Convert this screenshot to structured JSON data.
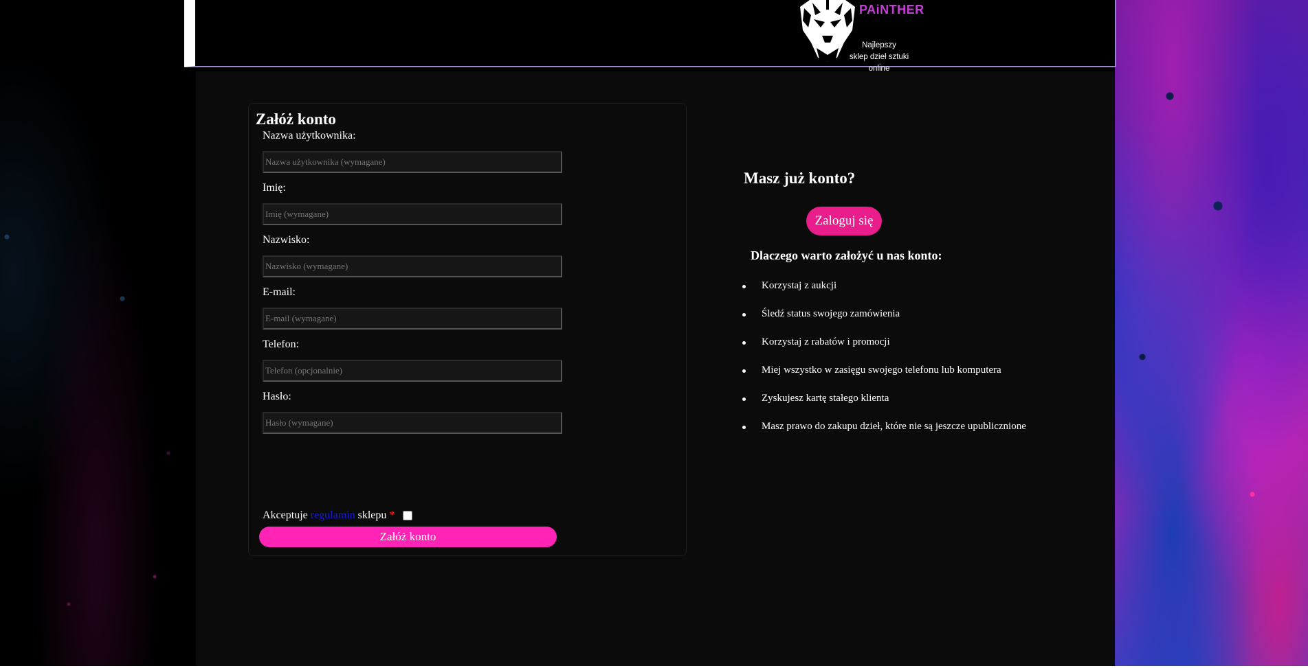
{
  "header": {
    "brand": "PAiNTHER",
    "tagline_line1": "Najlepszy",
    "tagline_line2": "sklep dzieł sztuki online"
  },
  "form": {
    "title": "Załóż konto",
    "fields": [
      {
        "label": "Nazwa użytkownika:",
        "placeholder": "Nazwa użytkownika (wymagane)",
        "value": ""
      },
      {
        "label": "Imię:",
        "placeholder": "Imię (wymagane)",
        "value": ""
      },
      {
        "label": "Nazwisko:",
        "placeholder": "Nazwisko (wymagane)",
        "value": ""
      },
      {
        "label": "E-mail:",
        "placeholder": "E-mail (wymagane)",
        "value": ""
      },
      {
        "label": "Telefon:",
        "placeholder": "Telefon (opcjonalnie)",
        "value": ""
      },
      {
        "label": "Hasło:",
        "placeholder": "Hasło (wymagane)",
        "value": ""
      }
    ],
    "terms_prefix": "Akceptuje",
    "terms_link": "regulamin",
    "terms_suffix": "sklepu",
    "terms_required": "*",
    "terms_checked": false,
    "submit_label": "Załóż konto"
  },
  "side": {
    "have_account": "Masz już konto?",
    "login_label": "Zaloguj się",
    "why_title": "Dlaczego warto założyć u nas konto:",
    "benefits": [
      "Korzystaj z aukcji",
      "Śledź status swojego zamówienia",
      "Korzystaj z rabatów i promocji",
      "Miej wszystko w zasięgu swojego telefonu lub komputera",
      "Zyskujesz kartę stałego klienta",
      "Masz prawo do zakupu dzieł, które nie są jeszcze upublicznione"
    ]
  },
  "colors": {
    "accent_pink": "#ff24b5",
    "login_pink": "#e91e8c",
    "brand_purple": "#c43fd6",
    "link_blue": "#1a1acc"
  }
}
